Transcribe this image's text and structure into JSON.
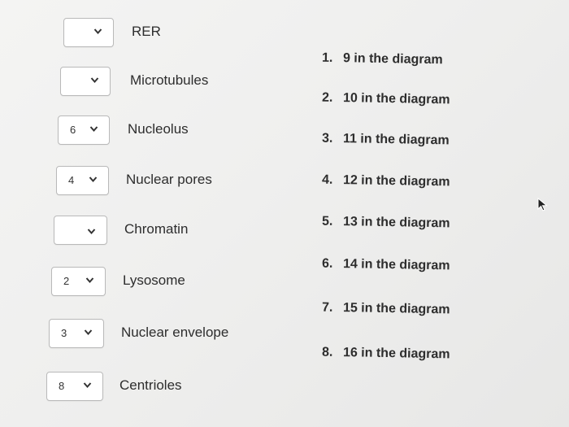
{
  "matches": [
    {
      "term": "RER",
      "selected": ""
    },
    {
      "term": "Microtubules",
      "selected": ""
    },
    {
      "term": "Nucleolus",
      "selected": "6"
    },
    {
      "term": "Nuclear pores",
      "selected": "4"
    },
    {
      "term": "Chromatin",
      "selected": ""
    },
    {
      "term": "Lysosome",
      "selected": "2"
    },
    {
      "term": "Nuclear envelope",
      "selected": "3"
    },
    {
      "term": "Centrioles",
      "selected": "8"
    }
  ],
  "answers": [
    {
      "num": "1.",
      "text": "9 in the diagram"
    },
    {
      "num": "2.",
      "text": "10 in the diagram"
    },
    {
      "num": "3.",
      "text": "11 in the diagram"
    },
    {
      "num": "4.",
      "text": "12 in the diagram"
    },
    {
      "num": "5.",
      "text": "13 in the diagram"
    },
    {
      "num": "6.",
      "text": "14 in the diagram"
    },
    {
      "num": "7.",
      "text": "15 in the diagram"
    },
    {
      "num": "8.",
      "text": "16 in the diagram"
    }
  ],
  "icons": {
    "dropdown": "chevron-down-icon",
    "pointer": "mouse-cursor-icon"
  },
  "colors": {
    "background": "#efefee",
    "box_border": "#b9b9b9",
    "text": "#2d2d2d"
  }
}
